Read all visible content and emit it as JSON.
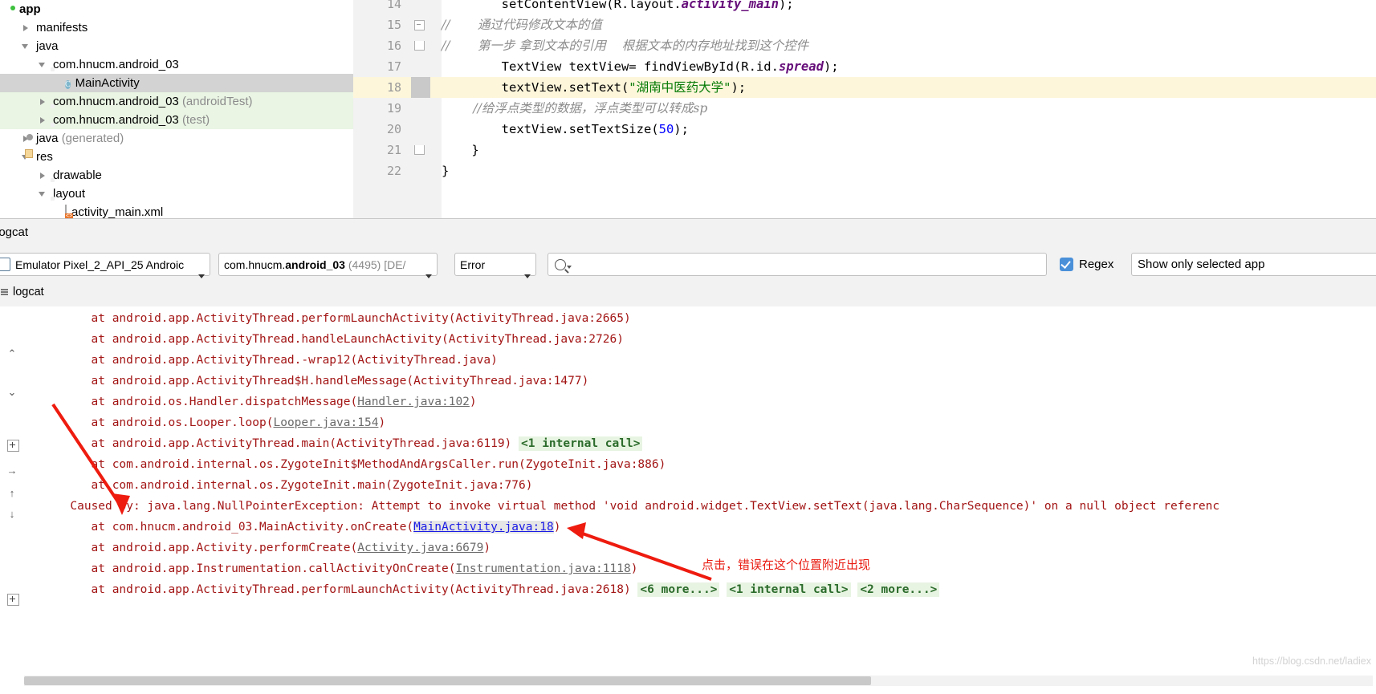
{
  "project_tree": {
    "items": [
      {
        "label": "app",
        "suffix": "",
        "depth": 0,
        "arrow": "none",
        "icon": "module-green-icon",
        "bold": true,
        "state": "normal"
      },
      {
        "label": "manifests",
        "suffix": "",
        "depth": 1,
        "arrow": "closed",
        "icon": "folder-blue-icon",
        "bold": false,
        "state": "normal"
      },
      {
        "label": "java",
        "suffix": "",
        "depth": 1,
        "arrow": "open",
        "icon": "folder-blue-icon",
        "bold": false,
        "state": "normal"
      },
      {
        "label": "com.hnucm.android_03",
        "suffix": "",
        "depth": 2,
        "arrow": "open",
        "icon": "package-icon",
        "bold": false,
        "state": "normal"
      },
      {
        "label": "MainActivity",
        "suffix": "",
        "depth": 3,
        "arrow": "none",
        "icon": "java-class-icon",
        "bold": false,
        "state": "selected"
      },
      {
        "label": "com.hnucm.android_03",
        "suffix": "(androidTest)",
        "depth": 2,
        "arrow": "closed",
        "icon": "package-icon",
        "bold": false,
        "state": "green"
      },
      {
        "label": "com.hnucm.android_03",
        "suffix": "(test)",
        "depth": 2,
        "arrow": "closed",
        "icon": "package-icon",
        "bold": false,
        "state": "green"
      },
      {
        "label": "java",
        "suffix": "(generated)",
        "depth": 1,
        "arrow": "closed",
        "icon": "generated-folder-icon",
        "bold": false,
        "state": "normal"
      },
      {
        "label": "res",
        "suffix": "",
        "depth": 1,
        "arrow": "open",
        "icon": "res-folder-icon",
        "bold": false,
        "state": "normal"
      },
      {
        "label": "drawable",
        "suffix": "",
        "depth": 2,
        "arrow": "closed",
        "icon": "package-icon",
        "bold": false,
        "state": "normal"
      },
      {
        "label": "layout",
        "suffix": "",
        "depth": 2,
        "arrow": "open",
        "icon": "package-icon",
        "bold": false,
        "state": "normal"
      },
      {
        "label": "activity_main.xml",
        "suffix": "",
        "depth": 3,
        "arrow": "none",
        "icon": "xml-file-icon",
        "bold": false,
        "state": "normal"
      }
    ]
  },
  "editor": {
    "lines": [
      {
        "num": "14",
        "clipped": true,
        "tokens": [
          {
            "t": "        setContentView(R.layout.",
            "c": "plain"
          },
          {
            "t": "activity_main",
            "c": "field"
          },
          {
            "t": ");",
            "c": "plain"
          }
        ]
      },
      {
        "num": "15",
        "fold": "mid",
        "tokens": [
          {
            "t": "//       通过代码修改文本的值",
            "c": "comment"
          }
        ]
      },
      {
        "num": "16",
        "fold": "end",
        "tokens": [
          {
            "t": "//       第一步 拿到文本的引用    根据文本的内存地址找到这个控件",
            "c": "comment"
          }
        ]
      },
      {
        "num": "17",
        "tokens": [
          {
            "t": "        TextView textView= findViewById(R.id.",
            "c": "plain"
          },
          {
            "t": "spread",
            "c": "field"
          },
          {
            "t": ");",
            "c": "plain"
          }
        ]
      },
      {
        "num": "18",
        "highlight": true,
        "tokens": [
          {
            "t": "        textView.setText(",
            "c": "plain"
          },
          {
            "t": "\"湖南中医药大学\"",
            "c": "string"
          },
          {
            "t": ");",
            "c": "plain"
          }
        ]
      },
      {
        "num": "19",
        "tokens": [
          {
            "t": "        //给浮点类型的数据，浮点类型可以转成sp",
            "c": "comment"
          }
        ]
      },
      {
        "num": "20",
        "tokens": [
          {
            "t": "        textView.setTextSize(",
            "c": "plain"
          },
          {
            "t": "50",
            "c": "number"
          },
          {
            "t": ");",
            "c": "plain"
          }
        ]
      },
      {
        "num": "21",
        "fold": "end",
        "tokens": [
          {
            "t": "    }",
            "c": "plain"
          }
        ]
      },
      {
        "num": "22",
        "tokens": [
          {
            "t": "}",
            "c": "plain"
          }
        ]
      }
    ]
  },
  "logcat": {
    "window_title": "logcat",
    "tab_label": "logcat",
    "device_selector": "Emulator Pixel_2_API_25 Androic",
    "process_selector_pre": "com.hnucm.",
    "process_selector_bold": "android_03",
    "process_selector_post": " (4495) [DE/",
    "level_selector": "Error",
    "search_placeholder": "",
    "search_value": "",
    "regex_label": "Regex",
    "regex_checked": true,
    "filter_selector": "Show only selected app",
    "lines": [
      {
        "indent": 5,
        "parts": [
          {
            "t": "at android.app.ActivityThread.performLaunchActivity(ActivityThread.java:2665)",
            "k": "plain"
          }
        ]
      },
      {
        "indent": 5,
        "parts": [
          {
            "t": "at android.app.ActivityThread.handleLaunchActivity(ActivityThread.java:2726)",
            "k": "plain"
          }
        ]
      },
      {
        "indent": 5,
        "parts": [
          {
            "t": "at android.app.ActivityThread.-wrap12(ActivityThread.java)",
            "k": "plain"
          }
        ]
      },
      {
        "indent": 5,
        "parts": [
          {
            "t": "at android.app.ActivityThread$H.handleMessage(ActivityThread.java:1477)",
            "k": "plain"
          }
        ]
      },
      {
        "indent": 5,
        "parts": [
          {
            "t": "at android.os.Handler.dispatchMessage(",
            "k": "plain"
          },
          {
            "t": "Handler.java:102",
            "k": "link"
          },
          {
            "t": ")",
            "k": "plain"
          }
        ]
      },
      {
        "indent": 5,
        "parts": [
          {
            "t": "at android.os.Looper.loop(",
            "k": "plain"
          },
          {
            "t": "Looper.java:154",
            "k": "link"
          },
          {
            "t": ")",
            "k": "plain"
          }
        ]
      },
      {
        "indent": 5,
        "parts": [
          {
            "t": "at android.app.ActivityThread.main(ActivityThread.java:6119) ",
            "k": "plain"
          },
          {
            "t": "<1 internal call>",
            "k": "chip"
          }
        ]
      },
      {
        "indent": 5,
        "parts": [
          {
            "t": "at com.android.internal.os.ZygoteInit$MethodAndArgsCaller.run(ZygoteInit.java:886)",
            "k": "plain"
          }
        ]
      },
      {
        "indent": 5,
        "parts": [
          {
            "t": "at com.android.internal.os.ZygoteInit.main(ZygoteInit.java:776)",
            "k": "plain"
          }
        ]
      },
      {
        "indent": 2,
        "parts": [
          {
            "t": "Caused by: java.lang.NullPointerException: Attempt to invoke virtual method 'void android.widget.TextView.setText(java.lang.CharSequence)' on a null object referenc",
            "k": "plain"
          }
        ]
      },
      {
        "indent": 5,
        "parts": [
          {
            "t": "at com.hnucm.android_03.MainActivity.onCreate(",
            "k": "plain"
          },
          {
            "t": "MainActivity.java:18",
            "k": "link-blue"
          },
          {
            "t": ")",
            "k": "plain"
          }
        ]
      },
      {
        "indent": 5,
        "parts": [
          {
            "t": "at android.app.Activity.performCreate(",
            "k": "plain"
          },
          {
            "t": "Activity.java:6679",
            "k": "link"
          },
          {
            "t": ")",
            "k": "plain"
          }
        ]
      },
      {
        "indent": 5,
        "parts": [
          {
            "t": "at android.app.Instrumentation.callActivityOnCreate(",
            "k": "plain"
          },
          {
            "t": "Instrumentation.java:1118",
            "k": "link"
          },
          {
            "t": ")",
            "k": "plain"
          }
        ]
      },
      {
        "indent": 5,
        "parts": [
          {
            "t": "at android.app.ActivityThread.performLaunchActivity(ActivityThread.java:2618) ",
            "k": "plain"
          },
          {
            "t": "<6 more...>",
            "k": "chip"
          },
          {
            "t": " ",
            "k": "plain"
          },
          {
            "t": "<1 internal call>",
            "k": "chip"
          },
          {
            "t": " ",
            "k": "plain"
          },
          {
            "t": "<2 more...>",
            "k": "chip"
          }
        ]
      }
    ]
  },
  "annotations": {
    "click_hint": "点击，错误在这个位置附近出现",
    "arrow_color": "#ee1b0f"
  },
  "watermark": "https://blog.csdn.net/ladiex",
  "colors": {
    "selection_gray": "#d3d3d3",
    "test_green": "#eaf5e4",
    "highlight_yellow": "#fdf6db",
    "log_red": "#a31515",
    "link_blue": "#1a1ae6",
    "accent_blue": "#4a90d9",
    "annotation_red": "#ee1b0f"
  }
}
